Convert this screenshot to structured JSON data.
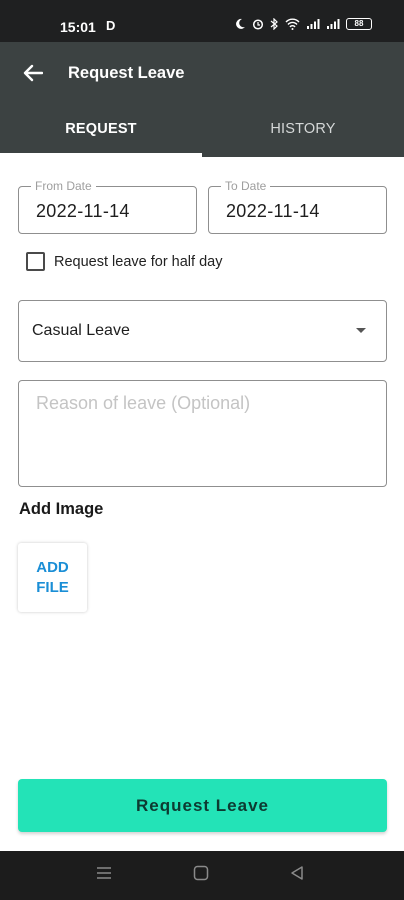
{
  "status_bar": {
    "time": "15:01",
    "extra_glyph": "D",
    "battery": "88",
    "icons": [
      "moon-icon",
      "alarm-icon",
      "bluetooth-icon",
      "wifi-icon",
      "signal-icon",
      "signal-icon"
    ]
  },
  "toolbar": {
    "title": "Request Leave",
    "back_icon": "arrow-left-icon"
  },
  "tabs": [
    {
      "label": "REQUEST",
      "active": true
    },
    {
      "label": "HISTORY",
      "active": false
    }
  ],
  "form": {
    "from_date": {
      "label": "From Date",
      "value": "2022-11-14"
    },
    "to_date": {
      "label": "To Date",
      "value": "2022-11-14"
    },
    "half_day": {
      "label": "Request leave for half day",
      "checked": false
    },
    "leave_type": {
      "value": "Casual Leave"
    },
    "reason": {
      "placeholder": "Reason of leave (Optional)",
      "value": ""
    },
    "add_image_heading": "Add Image",
    "add_file_label": "ADD FILE",
    "submit_label": "Request Leave"
  },
  "colors": {
    "status_bar": "#1f2021",
    "toolbar": "#3c4242",
    "accent_button": "#23e3b7",
    "link_blue": "#1a8ed6"
  },
  "nav_bar": {
    "icons": [
      "menu-icon",
      "home-square-icon",
      "back-triangle-icon"
    ]
  }
}
